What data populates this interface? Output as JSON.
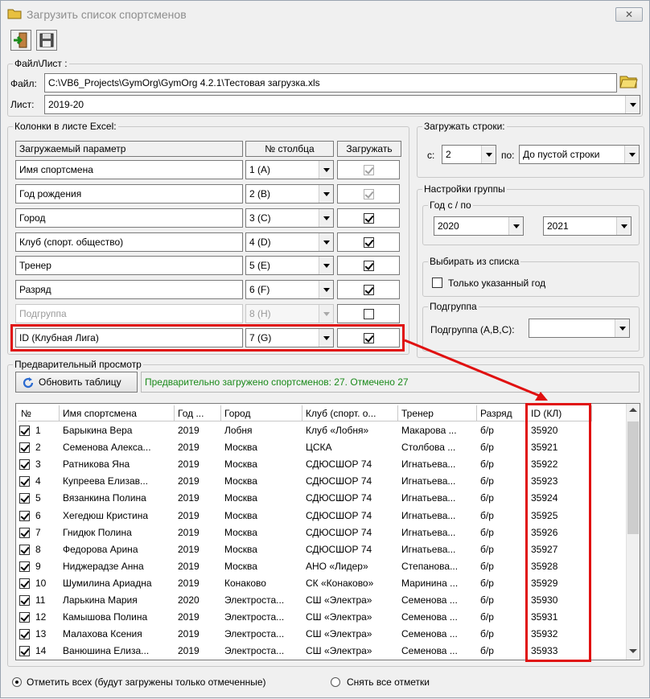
{
  "window": {
    "title": "Загрузить список спортсменов",
    "close": "✕"
  },
  "file_group": {
    "legend": "Файл\\Лист :",
    "file_label": "Файл:",
    "file_value": "C:\\VB6_Projects\\GymOrg\\GymOrg 4.2.1\\Тестовая загрузка.xls",
    "sheet_label": "Лист:",
    "sheet_value": "2019-20"
  },
  "columns_group": {
    "legend": "Колонки в листе Excel:",
    "headers": {
      "param": "Загружаемый параметр",
      "col": "№ столбца",
      "load": "Загружать"
    },
    "rows": [
      {
        "param": "Имя спортсмена",
        "col": "1 (A)",
        "checked": true,
        "disabled": false,
        "check_disabled": true
      },
      {
        "param": "Год рождения",
        "col": "2 (B)",
        "checked": true,
        "disabled": false,
        "check_disabled": true
      },
      {
        "param": "Город",
        "col": "3 (C)",
        "checked": true,
        "disabled": false,
        "check_disabled": false
      },
      {
        "param": "Клуб (спорт. общество)",
        "col": "4 (D)",
        "checked": true,
        "disabled": false,
        "check_disabled": false
      },
      {
        "param": "Тренер",
        "col": "5 (E)",
        "checked": true,
        "disabled": false,
        "check_disabled": false
      },
      {
        "param": "Разряд",
        "col": "6 (F)",
        "checked": true,
        "disabled": false,
        "check_disabled": false
      },
      {
        "param": "Подгруппа",
        "col": "8 (H)",
        "checked": false,
        "disabled": true,
        "check_disabled": false
      },
      {
        "param": "ID (Клубная Лига)",
        "col": "7 (G)",
        "checked": true,
        "disabled": false,
        "check_disabled": false
      }
    ]
  },
  "load_rows": {
    "legend": "Загружать строки:",
    "from_label": "с:",
    "from_value": "2",
    "to_label": "по:",
    "to_value": "До пустой строки"
  },
  "group_settings": {
    "legend": "Настройки группы",
    "year_legend": "Год с / по",
    "year_from": "2020",
    "year_to": "2021"
  },
  "select_list": {
    "legend": "Выбирать из списка",
    "only_year": "Только указанный год"
  },
  "subgroup": {
    "legend": "Подгруппа",
    "label": "Подгруппа (A,B,C):",
    "value": ""
  },
  "preview": {
    "legend": "Предварительный просмотр",
    "refresh": "Обновить таблицу",
    "status": "Предварительно загружено спортсменов: 27. Отмечено 27",
    "status_color": "#1a8a1a",
    "columns": [
      "№",
      "Имя спортсмена",
      "Год ...",
      "Город",
      "Клуб (спорт. о...",
      "Тренер",
      "Разряд",
      "ID (КЛ)"
    ],
    "rows": [
      [
        "1",
        "Барыкина Вера",
        "2019",
        "Лобня",
        "Клуб «Лобня»",
        "Макарова ...",
        "б/р",
        "35920"
      ],
      [
        "2",
        "Семенова Алекса...",
        "2019",
        "Москва",
        "ЦСКА",
        "Столбова ...",
        "б/р",
        "35921"
      ],
      [
        "3",
        "Ратникова Яна",
        "2019",
        "Москва",
        "СДЮСШОР 74",
        "Игнатьева...",
        "б/р",
        "35922"
      ],
      [
        "4",
        "Купреева Елизав...",
        "2019",
        "Москва",
        "СДЮСШОР 74",
        "Игнатьева...",
        "б/р",
        "35923"
      ],
      [
        "5",
        "Вязанкина Полина",
        "2019",
        "Москва",
        "СДЮСШОР 74",
        "Игнатьева...",
        "б/р",
        "35924"
      ],
      [
        "6",
        "Хегедюш Кристина",
        "2019",
        "Москва",
        "СДЮСШОР 74",
        "Игнатьева...",
        "б/р",
        "35925"
      ],
      [
        "7",
        "Гнидюк Полина",
        "2019",
        "Москва",
        "СДЮСШОР 74",
        "Игнатьева...",
        "б/р",
        "35926"
      ],
      [
        "8",
        "Федорова Арина",
        "2019",
        "Москва",
        "СДЮСШОР 74",
        "Игнатьева...",
        "б/р",
        "35927"
      ],
      [
        "9",
        "Ниджерадзе Анна",
        "2019",
        "Москва",
        "АНО «Лидер»",
        "Степанова...",
        "б/р",
        "35928"
      ],
      [
        "10",
        "Шумилина Ариадна",
        "2019",
        "Конаково",
        "СК «Конаково»",
        "Маринина ...",
        "б/р",
        "35929"
      ],
      [
        "11",
        "Ларькина Мария",
        "2020",
        "Электроста...",
        "СШ «Электра»",
        "Семенова ...",
        "б/р",
        "35930"
      ],
      [
        "12",
        "Камышова Полина",
        "2019",
        "Электроста...",
        "СШ «Электра»",
        "Семенова ...",
        "б/р",
        "35931"
      ],
      [
        "13",
        "Малахова Ксения",
        "2019",
        "Электроста...",
        "СШ «Электра»",
        "Семенова ...",
        "б/р",
        "35932"
      ],
      [
        "14",
        "Ванюшина Елиза...",
        "2019",
        "Электроста...",
        "СШ «Электра»",
        "Семенова ...",
        "б/р",
        "35933"
      ]
    ]
  },
  "bottom": {
    "check_all": "Отметить всех (будут загружены только отмеченные)",
    "uncheck_all": "Снять все отметки"
  },
  "colors": {
    "highlight": "#e01010"
  }
}
